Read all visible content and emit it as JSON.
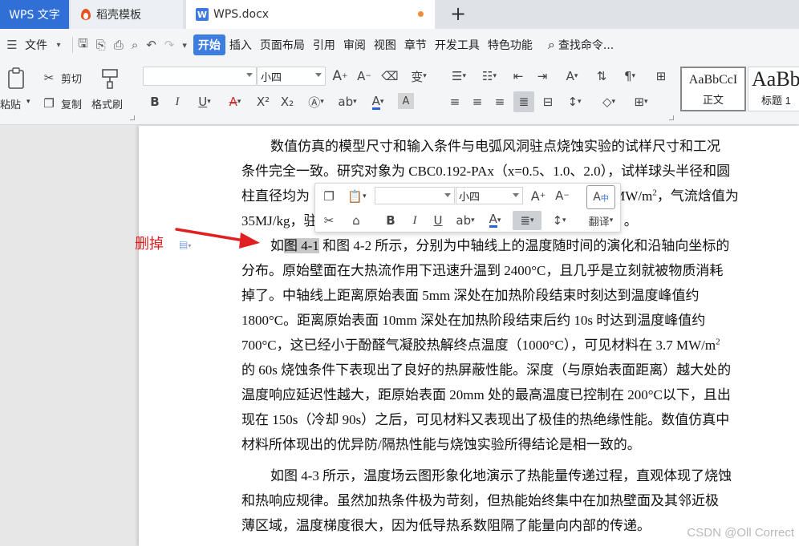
{
  "tabs": {
    "app": "WPS 文字",
    "template": "稻壳模板",
    "doc": "WPS.docx",
    "new_tab": "+"
  },
  "menu": {
    "file": "文件",
    "items": [
      "开始",
      "插入",
      "页面布局",
      "引用",
      "审阅",
      "视图",
      "章节",
      "开发工具",
      "特色功能"
    ],
    "search": "查找命令..."
  },
  "toolbar": {
    "paste": "粘贴",
    "cut": "剪切",
    "copy": "复制",
    "format_painter": "格式刷",
    "font_name": "",
    "font_size": "小四",
    "bold": "B",
    "italic": "I",
    "underline": "U",
    "strike": "A",
    "superscript": "X²",
    "subscript": "X₂",
    "font_color": "A",
    "styles": [
      {
        "sample": "AaBbCcI",
        "name": "正文"
      },
      {
        "sample": "AaBb",
        "name": "标题 1"
      }
    ]
  },
  "mini_toolbar": {
    "font_name": "",
    "font_size": "小四",
    "bold": "B",
    "italic": "I",
    "underline": "U",
    "font_color": "A",
    "translate": "翻译"
  },
  "annotation": {
    "label": "删掉",
    "color": "#e02020"
  },
  "document": {
    "p1": [
      "数值仿真的模型尺寸和输入条件与电弧风洞驻点烧蚀实验的试样尺寸和工况",
      "条件完全一致。研究对象为 CBC0.192-PAx（x=0.5、1.0、2.0），试样球头半径和圆",
      "柱直径均为",
      "MW/m",
      "，气流焓值为",
      "35MJ/kg，驻",
      "。"
    ],
    "p2_first_prefix": "如",
    "p2_selected": "图 4-1",
    "p2_first_rest": " 和图 4-2 所示，分别为中轴线上的温度随时间的演化和沿轴向坐标的",
    "p2": [
      "分布。原始壁面在大热流作用下迅速升温到 2400°C，且几乎是立刻就被物质消耗",
      "掉了。中轴线上距离原始表面 5mm 深处在加热阶段结束时刻达到温度峰值约",
      "1800°C。距离原始表面 10mm 深处在加热阶段结束后约 10s 时达到温度峰值约",
      "700°C，这已经小于酚醛气凝胶热解终点温度（1000°C），可见材料在 3.7 MW/m",
      "的 60s 烧蚀条件下表现出了良好的热屏蔽性能。深度（与原始表面距离）越大处的",
      "温度响应延迟性越大，距原始表面 20mm 处的最高温度已控制在 200°C以下，且出",
      "现在 150s（冷却 90s）之后，可见材料又表现出了极佳的热绝缘性能。数值仿真中",
      "材料所体现出的优异防/隔热性能与烧蚀实验所得结论是相一致的。"
    ],
    "p3": [
      "如图 4-3 所示，温度场云图形象化地演示了热能量传递过程，直观体现了烧蚀",
      "和热响应规律。虽然加热条件极为苛刻，但热能始终集中在加热壁面及其邻近极",
      "薄区域，温度梯度很大，因为低导热系数阻隔了能量向内部的传递。"
    ],
    "sup2": "2"
  },
  "watermark": "CSDN @Oll Correct"
}
